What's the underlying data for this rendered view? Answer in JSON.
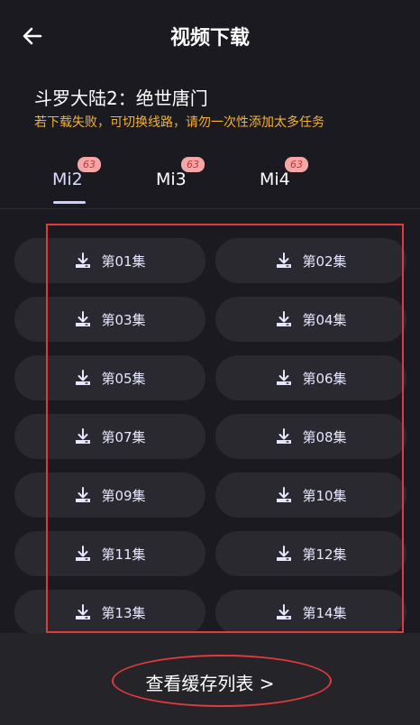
{
  "header": {
    "title": "视频下载",
    "back_icon": "arrow-left-icon"
  },
  "video": {
    "title": "斗罗大陆2：绝世唐门",
    "notice": "若下载失败，可切换线路，请勿一次性添加太多任务"
  },
  "tabs": [
    {
      "label": "Mi2",
      "badge": "63",
      "active": true
    },
    {
      "label": "Mi3",
      "badge": "63",
      "active": false
    },
    {
      "label": "Mi4",
      "badge": "63",
      "active": false
    }
  ],
  "episodes": [
    {
      "label": "第01集"
    },
    {
      "label": "第02集"
    },
    {
      "label": "第03集"
    },
    {
      "label": "第04集"
    },
    {
      "label": "第05集"
    },
    {
      "label": "第06集"
    },
    {
      "label": "第07集"
    },
    {
      "label": "第08集"
    },
    {
      "label": "第09集"
    },
    {
      "label": "第10集"
    },
    {
      "label": "第11集"
    },
    {
      "label": "第12集"
    },
    {
      "label": "第13集"
    },
    {
      "label": "第14集"
    }
  ],
  "footer": {
    "cache_list_label": "查看缓存列表 >"
  },
  "colors": {
    "background": "#1b1a20",
    "notice": "#f0b23a",
    "badge": "#f5a7a7",
    "annotation": "#e0393e"
  }
}
